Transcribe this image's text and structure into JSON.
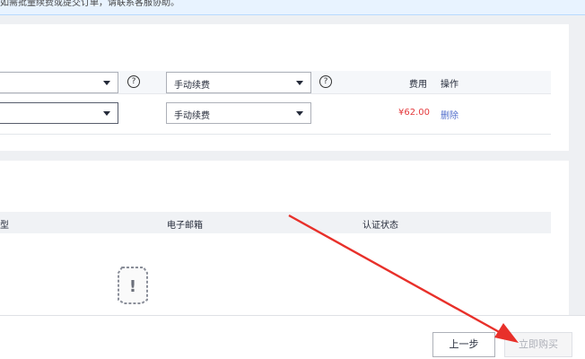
{
  "notice": {
    "text": "如需批量续费或提交订单，请联系客服协助。"
  },
  "renewal": {
    "row1": {
      "mode": "手动续费"
    },
    "row2": {
      "mode": "手动续费",
      "price": "¥62.00",
      "delete_label": "删除"
    },
    "help_glyph": "?",
    "headers": {
      "fee": "费用",
      "action": "操作"
    }
  },
  "contacts": {
    "headers": {
      "type": "型",
      "email": "电子邮箱",
      "status": "认证状态"
    },
    "empty_icon_glyph": "!"
  },
  "footer": {
    "prev_label": "上一步",
    "buy_label": "立即购买"
  },
  "colors": {
    "price_red": "#e4393c",
    "link_blue": "#526ecc",
    "arrow_red": "#e8302a"
  }
}
